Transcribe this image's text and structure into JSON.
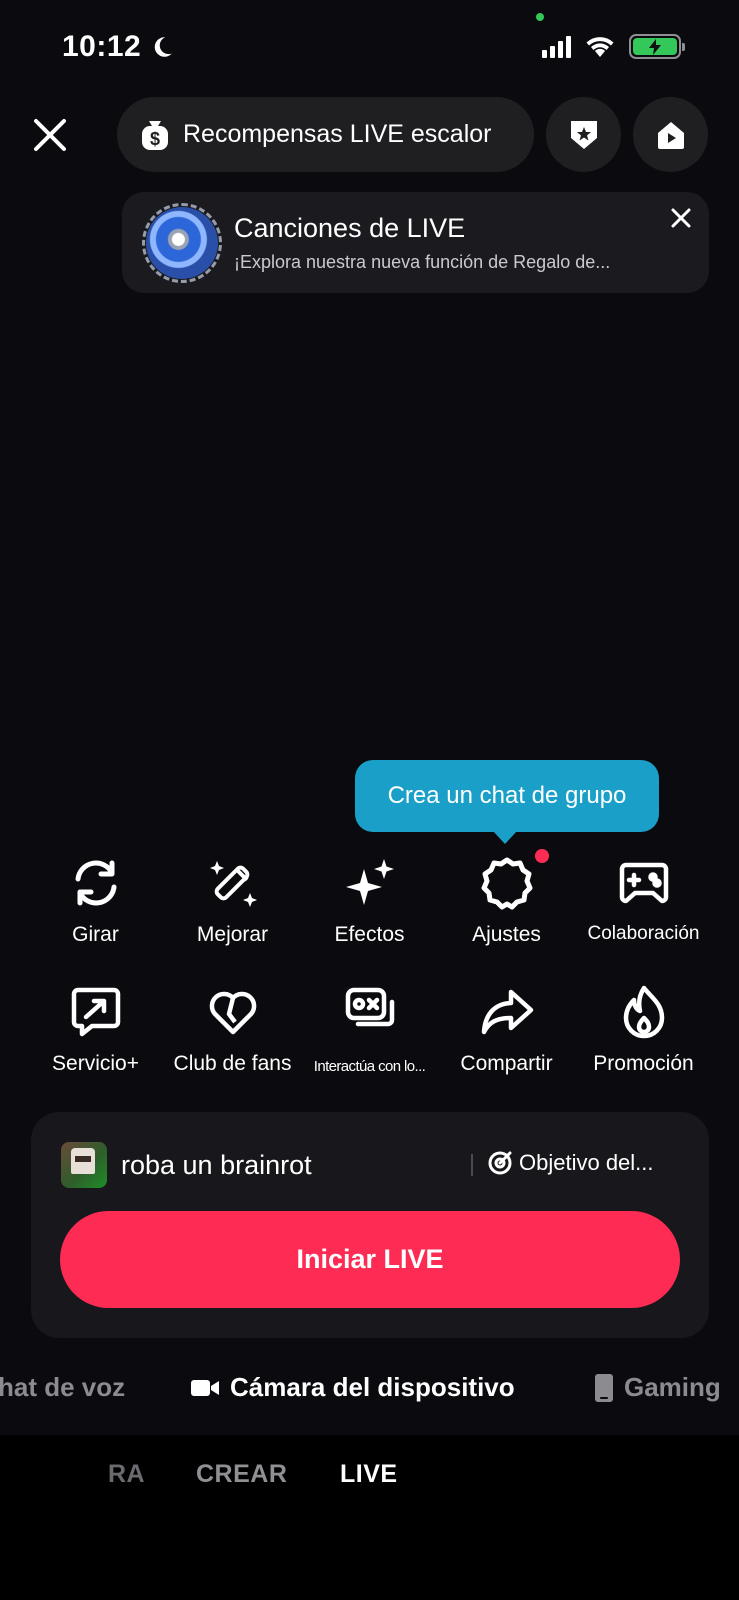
{
  "status_bar": {
    "time": "10:12"
  },
  "top_bar": {
    "rewards_label": "Recompensas LIVE escalor"
  },
  "banner": {
    "title": "Canciones de LIVE",
    "subtitle": "¡Explora nuestra nueva función de Regalo de..."
  },
  "tooltip": {
    "text": "Crea un chat de grupo"
  },
  "tools_row1": [
    {
      "label": "Girar",
      "icon": "rotate-icon"
    },
    {
      "label": "Mejorar",
      "icon": "magic-wand-icon"
    },
    {
      "label": "Efectos",
      "icon": "sparkles-icon"
    },
    {
      "label": "Ajustes",
      "icon": "gear-icon"
    },
    {
      "label": "Colaboración",
      "icon": "gamepad-icon"
    }
  ],
  "tools_row2": [
    {
      "label": "Servicio+",
      "icon": "service-icon"
    },
    {
      "label": "Club de fans",
      "icon": "heart-icon"
    },
    {
      "label": "Interactúa con lo...",
      "icon": "interact-icon"
    },
    {
      "label": "Compartir",
      "icon": "share-icon"
    },
    {
      "label": "Promoción",
      "icon": "flame-icon"
    }
  ],
  "live_card": {
    "title": "roba un brainrot",
    "goal_label": "Objetivo del...",
    "start_button": "Iniciar LIVE"
  },
  "sources": {
    "left": "hat de voz",
    "center": "Cámara del dispositivo",
    "right": "Gaming"
  },
  "modes": {
    "faded": "RA",
    "create": "CREAR",
    "live": "LIVE"
  },
  "colors": {
    "accent": "#fe2c55",
    "tooltip": "#1aa0c8",
    "background": "#0b0a0e"
  }
}
